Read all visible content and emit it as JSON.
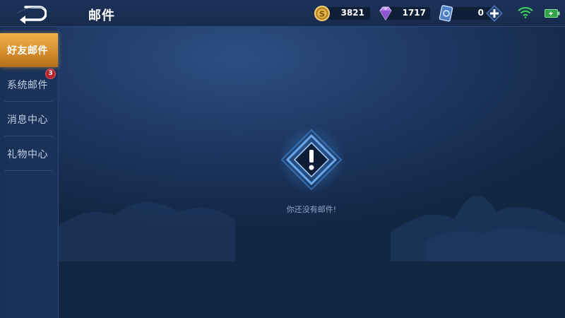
{
  "header": {
    "title": "邮件",
    "back_icon": "back-arrow-icon"
  },
  "resources": {
    "gold": {
      "icon": "gold-coin-icon",
      "value": "3821"
    },
    "gem": {
      "icon": "diamond-icon",
      "value": "1717"
    },
    "ticket": {
      "icon": "voucher-icon",
      "value": "0"
    },
    "add_icon": "plus-icon"
  },
  "status": {
    "wifi_icon": "wifi-icon",
    "battery_icon": "battery-icon"
  },
  "sidebar": {
    "items": [
      {
        "label": "好友邮件",
        "active": true
      },
      {
        "label": "系统邮件",
        "active": false,
        "badge": "3"
      },
      {
        "label": "消息中心",
        "active": false
      },
      {
        "label": "礼物中心",
        "active": false
      }
    ]
  },
  "empty_state": {
    "icon": "exclamation-diamond-icon",
    "message": "你还没有邮件!"
  },
  "colors": {
    "accent_active": "#e9a23c",
    "background": "#1f3a66",
    "badge": "#b3262b"
  }
}
